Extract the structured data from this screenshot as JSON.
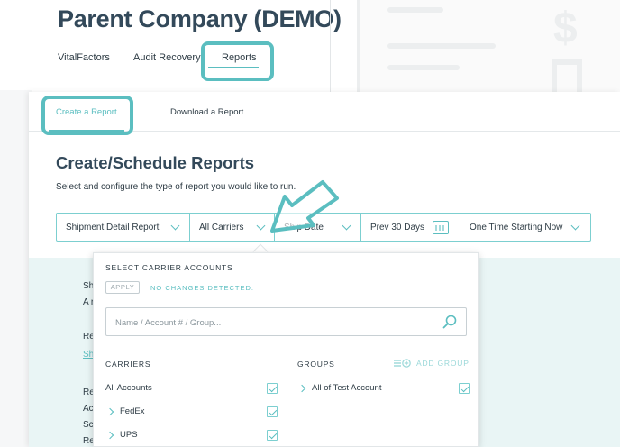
{
  "company": {
    "title": "Parent Company (DEMO)"
  },
  "top_nav": {
    "vitalfactors": "VitalFactors",
    "audit_recovery": "Audit Recovery",
    "reports": "Reports"
  },
  "tabs": {
    "create": "Create a Report",
    "download": "Download a Report"
  },
  "page": {
    "heading": "Create/Schedule Reports",
    "subtitle": "Select and configure the type of report you would like to run."
  },
  "filters": {
    "report_type": "Shipment Detail Report",
    "carriers": "All Carriers",
    "date_type": "Ship Date",
    "date_range": "Prev 30 Days",
    "schedule": "One Time Starting Now"
  },
  "dropdown": {
    "title": "SELECT CARRIER ACCOUNTS",
    "apply_label": "APPLY",
    "status": "NO CHANGES DETECTED.",
    "search_placeholder": "Name / Account # / Group...",
    "carriers_header": "CARRIERS",
    "groups_header": "GROUPS",
    "add_group_label": "ADD GROUP",
    "carriers": [
      {
        "label": "All Accounts",
        "checked": true
      },
      {
        "label": "FedEx",
        "checked": true
      },
      {
        "label": "UPS",
        "checked": true
      }
    ],
    "groups": [
      {
        "label": "All of Test Account",
        "checked": true
      }
    ]
  },
  "colors": {
    "accent": "#5bbec0",
    "heading": "#33495a",
    "teal_bg": "#e9f5f5"
  },
  "icons": [
    "chevron-down-icon",
    "calendar-icon",
    "search-icon",
    "add-group-icon",
    "chevron-right-icon",
    "check-icon",
    "dollar-icon"
  ]
}
